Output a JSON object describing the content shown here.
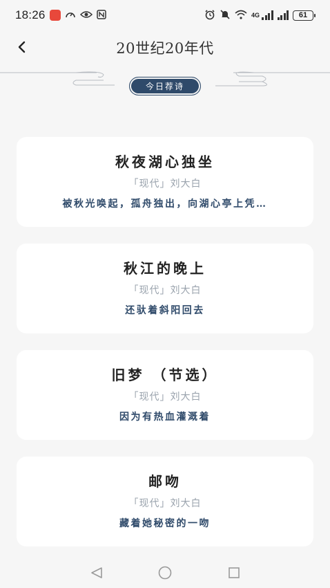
{
  "status": {
    "time": "18:26",
    "network": "4G",
    "battery": "61"
  },
  "header": {
    "title": "20世纪20年代"
  },
  "tag": {
    "label": "今日荐诗"
  },
  "poems": [
    {
      "title": "秋夜湖心独坐",
      "meta": "「现代」刘大白",
      "excerpt": "被秋光唤起，孤舟独出，向湖心亭上凭…"
    },
    {
      "title": "秋江的晚上",
      "meta": "「现代」刘大白",
      "excerpt": "还驮着斜阳回去"
    },
    {
      "title": "旧梦 （节选）",
      "meta": "「现代」刘大白",
      "excerpt": "因为有热血灌溉着"
    },
    {
      "title": "邮吻",
      "meta": "「现代」刘大白",
      "excerpt": "藏着她秘密的一吻"
    }
  ],
  "icons": {
    "back": "chevron-left-icon",
    "nav_back": "triangle-back-icon",
    "nav_home": "circle-home-icon",
    "nav_recents": "square-recents-icon"
  },
  "colors": {
    "accent": "#2f4a6a",
    "background": "#f6f6f6",
    "card": "#ffffff",
    "meta_text": "#9aa3ad"
  }
}
